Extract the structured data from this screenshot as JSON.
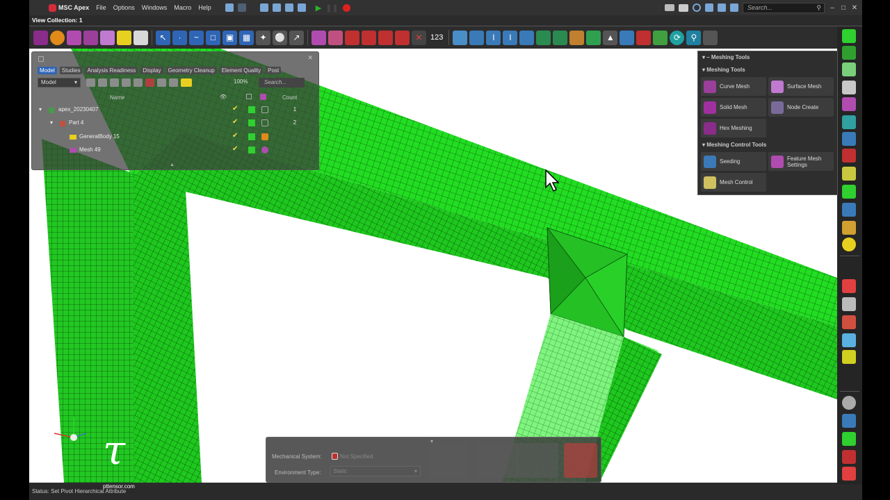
{
  "app": {
    "title": "MSC Apex"
  },
  "menubar": {
    "items": [
      "File",
      "Options",
      "Windows",
      "Macro",
      "Help"
    ],
    "search_placeholder": "Search..."
  },
  "view_collection": {
    "label": "View Collection: 1"
  },
  "toolbar": {
    "counter_label": "123"
  },
  "model_panel": {
    "tabs": [
      "Model",
      "Studies",
      "Analysis Readiness",
      "Display",
      "Geometry Cleanup",
      "Element Quality",
      "Post"
    ],
    "active_tab": "Model",
    "dropdown": "Model",
    "zoom": "100%",
    "search_placeholder": "Search...",
    "headers": {
      "name": "Name",
      "count": "Count"
    },
    "tree": [
      {
        "label": "apex_20230407",
        "count": "1"
      },
      {
        "label": "Part 4",
        "count": "2"
      },
      {
        "label": "GeneralBody 15",
        "count": ""
      },
      {
        "label": "Mesh 49",
        "count": ""
      }
    ]
  },
  "meshing_panel": {
    "title": "Meshing Tools",
    "section1": "Meshing Tools",
    "buttons1": [
      "Curve Mesh",
      "Surface Mesh",
      "Solid Mesh",
      "Node Create",
      "Hex Meshing"
    ],
    "section2": "Meshing Control Tools",
    "buttons2": [
      "Seeding",
      "Feature Mesh Settings",
      "Mesh Control"
    ]
  },
  "environment": {
    "mechanical_system_label": "Mechanical System:",
    "mechanical_system_value": "Not Specified",
    "environment_type_label": "Environment Type:",
    "environment_type_value": "Static"
  },
  "status": {
    "text": "Status:  Set Pivot Hierarchical Attribute"
  },
  "watermark": {
    "url": "pttensor.com"
  },
  "colors": {
    "mesh": "#22dd22",
    "mesh_light": "#7ff47f",
    "accent": "#2f65b5",
    "panel": "#2e2e2e"
  }
}
